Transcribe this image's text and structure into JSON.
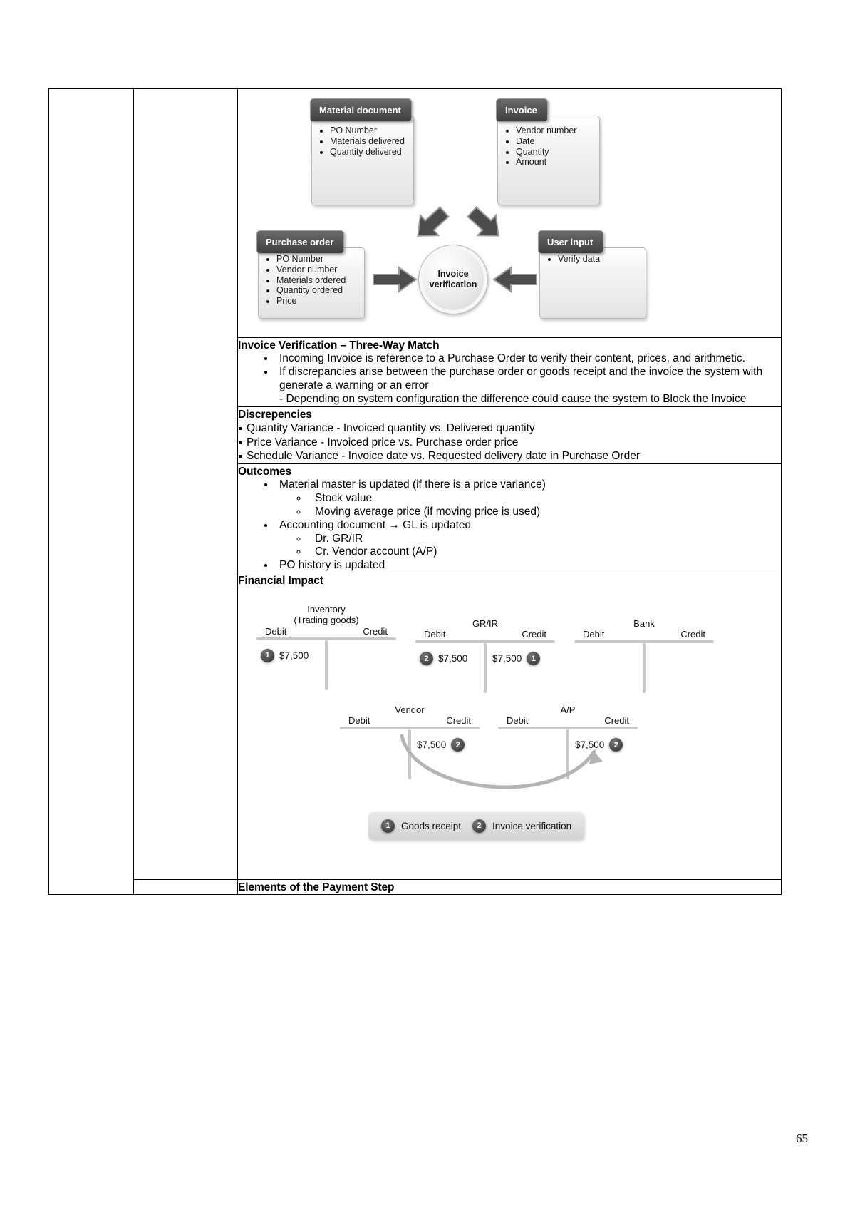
{
  "page": {
    "number": "65"
  },
  "flow_diagram": {
    "boxes": [
      {
        "title": "Material document",
        "items": [
          "PO Number",
          "Materials delivered",
          "Quantity delivered"
        ]
      },
      {
        "title": "Invoice",
        "items": [
          "Vendor number",
          "Date",
          "Quantity",
          "Amount"
        ]
      },
      {
        "title": "Purchase order",
        "items": [
          "PO Number",
          "Vendor number",
          "Materials ordered",
          "Quantity ordered",
          "Price"
        ]
      },
      {
        "title": "User input",
        "items": [
          "Verify data"
        ]
      }
    ],
    "center_node": {
      "line1": "Invoice",
      "line2": "verification"
    }
  },
  "sections": {
    "three_way_match": {
      "heading": "Invoice Verification – Three-Way Match",
      "bullets": [
        "Incoming Invoice is reference to a Purchase Order to verify their content, prices, and arithmetic.",
        "If discrepancies arise between the purchase order or goods receipt and the invoice the system with generate a warning or an error",
        "- Depending on system configuration the difference could cause the system to Block the Invoice"
      ]
    },
    "discrepancies": {
      "heading": "Discrepencies",
      "items": [
        "Quantity Variance - Invoiced quantity vs. Delivered quantity",
        "Price Variance - Invoiced price vs. Purchase order price",
        "Schedule Variance - Invoice date vs. Requested delivery date in Purchase Order"
      ]
    },
    "outcomes": {
      "heading": "Outcomes",
      "bullets": [
        {
          "text": "Material master is updated (if there is a price variance)",
          "sub": [
            "Stock value",
            "Moving average price (if moving price is used)"
          ]
        },
        {
          "text": "Accounting document → GL is updated",
          "sub": [
            "Dr. GR/IR",
            "Cr. Vendor account (A/P)"
          ]
        },
        {
          "text": "PO history is updated",
          "sub": []
        }
      ]
    },
    "financial_impact": {
      "heading": "Financial Impact"
    },
    "payment_step": {
      "heading": "Elements of the Payment Step"
    }
  },
  "t_accounts": {
    "debit_label": "Debit",
    "credit_label": "Credit",
    "accounts": [
      {
        "title_line1": "Inventory",
        "title_line2": "(Trading goods)",
        "debit_amount": "$7,500",
        "debit_badge": "1",
        "credit_amount": "",
        "credit_badge": ""
      },
      {
        "title_line1": "GR/IR",
        "title_line2": "",
        "debit_amount": "$7,500",
        "debit_badge": "2",
        "credit_amount": "$7,500",
        "credit_badge": "1"
      },
      {
        "title_line1": "Bank",
        "title_line2": "",
        "debit_amount": "",
        "debit_badge": "",
        "credit_amount": "",
        "credit_badge": ""
      },
      {
        "title_line1": "Vendor",
        "title_line2": "",
        "debit_amount": "",
        "debit_badge": "",
        "credit_amount": "$7,500",
        "credit_badge": "2"
      },
      {
        "title_line1": "A/P",
        "title_line2": "",
        "debit_amount": "",
        "debit_badge": "",
        "credit_amount": "$7,500",
        "credit_badge": "2"
      }
    ],
    "legend": [
      {
        "badge": "1",
        "label": "Goods receipt"
      },
      {
        "badge": "2",
        "label": "Invoice verification"
      }
    ]
  }
}
